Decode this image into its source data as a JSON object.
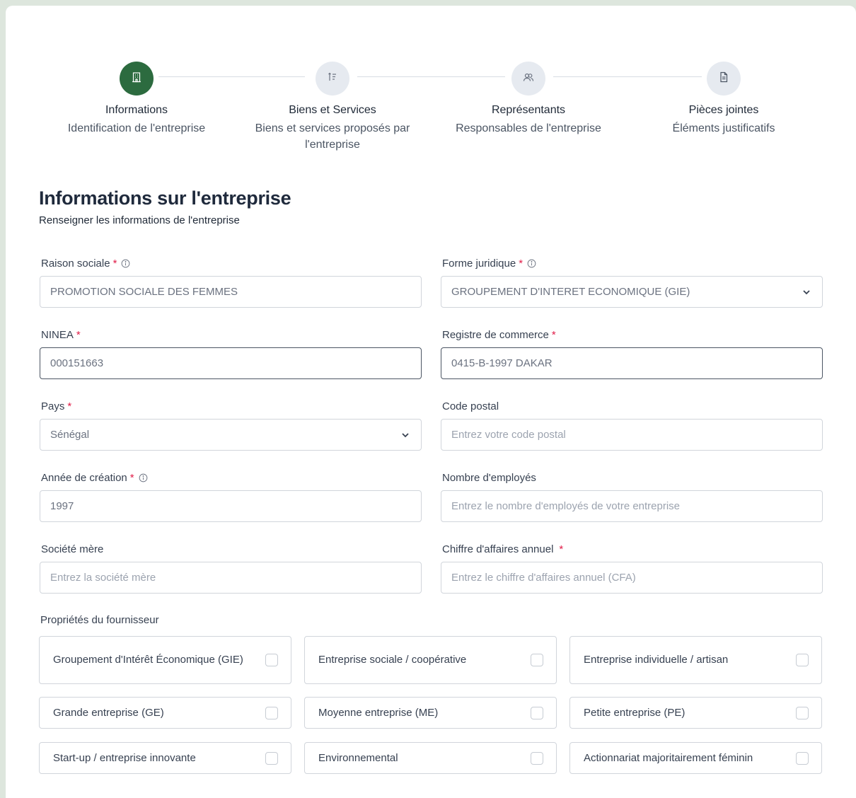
{
  "stepper": {
    "steps": [
      {
        "title": "Informations",
        "subtitle": "Identification de l'entreprise",
        "icon": "building-icon",
        "active": true
      },
      {
        "title": "Biens et Services",
        "subtitle": "Biens et services proposés par l'entreprise",
        "icon": "list-sort-icon",
        "active": false
      },
      {
        "title": "Représentants",
        "subtitle": "Responsables de l'entreprise",
        "icon": "users-icon",
        "active": false
      },
      {
        "title": "Pièces jointes",
        "subtitle": "Éléments justificatifs",
        "icon": "document-icon",
        "active": false
      }
    ]
  },
  "section": {
    "title": "Informations sur l'entreprise",
    "subtitle": "Renseigner les informations de l'entreprise"
  },
  "form": {
    "raison_sociale": {
      "label": "Raison sociale",
      "required": "*",
      "value": "PROMOTION SOCIALE DES FEMMES"
    },
    "forme_juridique": {
      "label": "Forme juridique",
      "required": "*",
      "value": "GROUPEMENT D'INTERET ECONOMIQUE (GIE)"
    },
    "ninea": {
      "label": "NINEA",
      "required": "*",
      "value": "000151663"
    },
    "registre_commerce": {
      "label": "Registre de commerce",
      "required": "*",
      "value": "0415-B-1997 DAKAR"
    },
    "pays": {
      "label": "Pays",
      "required": "*",
      "value": "Sénégal"
    },
    "code_postal": {
      "label": "Code postal",
      "placeholder": "Entrez votre code postal"
    },
    "annee_creation": {
      "label": "Année de création",
      "required": "*",
      "value": "1997"
    },
    "nombre_employes": {
      "label": "Nombre d'employés",
      "placeholder": "Entrez le nombre d'employés de votre entreprise"
    },
    "societe_mere": {
      "label": "Société mère",
      "placeholder": "Entrez la société mère"
    },
    "chiffre_affaires": {
      "label": "Chiffre d'affaires annuel",
      "required": "*",
      "placeholder": "Entrez le chiffre d'affaires annuel (CFA)"
    }
  },
  "properties": {
    "label": "Propriétés du fournisseur",
    "items": [
      {
        "label": "Groupement d'Intérêt Économique (GIE)",
        "checked": false
      },
      {
        "label": "Entreprise sociale / coopérative",
        "checked": false
      },
      {
        "label": "Entreprise individuelle / artisan",
        "checked": false
      },
      {
        "label": "Grande entreprise (GE)",
        "checked": false
      },
      {
        "label": "Moyenne entreprise (ME)",
        "checked": false
      },
      {
        "label": "Petite entreprise (PE)",
        "checked": false
      },
      {
        "label": "Start-up / entreprise innovante",
        "checked": false
      },
      {
        "label": "Environnemental",
        "checked": false
      },
      {
        "label": "Actionnariat majoritairement féminin",
        "checked": false
      }
    ]
  },
  "colors": {
    "accent": "#2c6b3f",
    "required": "#e11d48",
    "step_inactive": "#e6eaf0"
  }
}
